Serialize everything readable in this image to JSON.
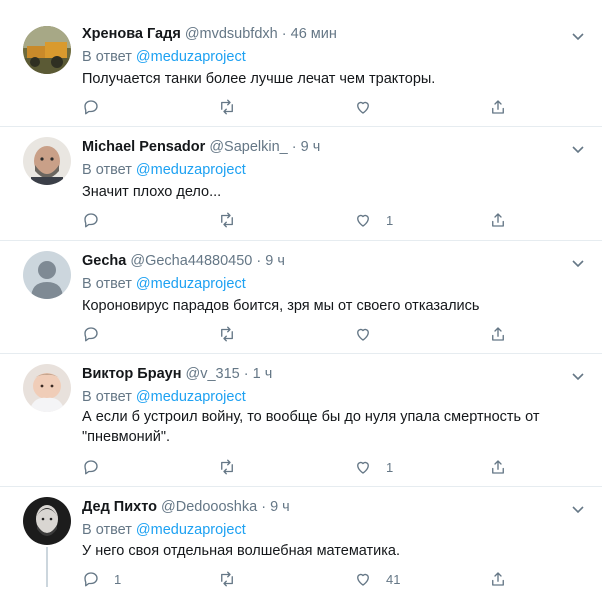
{
  "tweets": [
    {
      "name": "Хренова Гадя",
      "handle": "@mvdsubfdxh",
      "sep": "·",
      "time": "46 мин",
      "reply_prefix": "В ответ",
      "reply_to": "@meduzaproject",
      "text": "Получается танки более лучше лечат чем тракторы.",
      "reply_count": "",
      "retweet_count": "",
      "like_count": ""
    },
    {
      "name": "Michael Pensador",
      "handle": "@Sapelkin_",
      "sep": "·",
      "time": "9 ч",
      "reply_prefix": "В ответ",
      "reply_to": "@meduzaproject",
      "text": "Значит плохо дело...",
      "reply_count": "",
      "retweet_count": "",
      "like_count": "1"
    },
    {
      "name": "Gecha",
      "handle": "@Gecha44880450",
      "sep": "·",
      "time": "9 ч",
      "reply_prefix": "В ответ",
      "reply_to": "@meduzaproject",
      "text": "Короновирус парадов боится, зря мы от своего отказались",
      "reply_count": "",
      "retweet_count": "",
      "like_count": ""
    },
    {
      "name": "Виктор Браун",
      "handle": "@v_315",
      "sep": "·",
      "time": "1 ч",
      "reply_prefix": "В ответ",
      "reply_to": "@meduzaproject",
      "text": "А если б устроил войну, то вообще бы до нуля упала смертность от \"пневмоний\".",
      "reply_count": "",
      "retweet_count": "",
      "like_count": "1"
    },
    {
      "name": "Дед Пихто",
      "handle": "@Dedoooshka",
      "sep": "·",
      "time": "9 ч",
      "reply_prefix": "В ответ",
      "reply_to": "@meduzaproject",
      "text": "У него своя отдельная волшебная математика.",
      "reply_count": "1",
      "retweet_count": "",
      "like_count": "41"
    }
  ],
  "colors": {
    "link": "#1da1f2",
    "secondary": "#657786",
    "divider": "#e6ecf0"
  },
  "icons": [
    "reply-icon",
    "retweet-icon",
    "like-icon",
    "share-icon",
    "chevron-down-icon"
  ]
}
